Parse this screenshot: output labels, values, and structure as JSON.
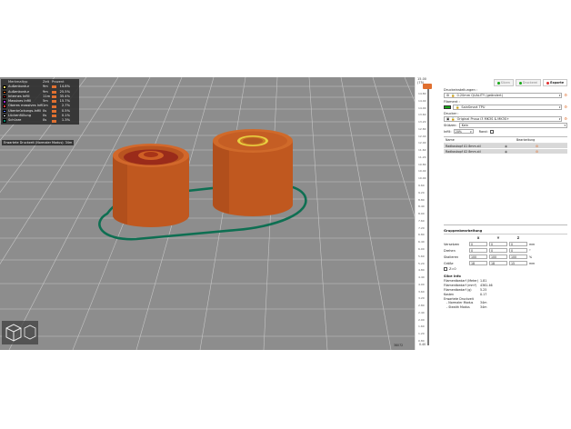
{
  "legend": {
    "headers": {
      "name": "Merkmaltyp",
      "time": "Zeit",
      "percent": "Prozent"
    },
    "items": [
      {
        "name": "Außenkontur",
        "time": "9m",
        "percent": "14.8%",
        "color": "#ffe066"
      },
      {
        "name": "Außenkontur",
        "time": "9m",
        "percent": "25.5%",
        "color": "#ff7a2a"
      },
      {
        "name": "Internes Infill",
        "time": "11m",
        "percent": "35.4%",
        "color": "#b01818"
      },
      {
        "name": "Massives Infill",
        "time": "5m",
        "percent": "15.7%",
        "color": "#a030d0"
      },
      {
        "name": "Oberes massives Infill",
        "time": "1m",
        "percent": "2.7%",
        "color": "#ff4040"
      },
      {
        "name": "Überbrückungs-Infill",
        "time": "0s",
        "percent": "0.5%",
        "color": "#6080ff"
      },
      {
        "name": "Lückenfüllung",
        "time": "0s",
        "percent": "0.1%",
        "color": "#ffffff"
      },
      {
        "name": "Schürze",
        "time": "0s",
        "percent": "1.3%",
        "color": "#00856a"
      }
    ],
    "estimate": "Erwartete Druckzeit (Normaler Modus): 34m"
  },
  "viewport": {
    "coord": "38072"
  },
  "vslider": {
    "top_label": "15.00",
    "top_sub": "(75)",
    "bottom_label": "0.40",
    "ticks": [
      "14.80",
      "14.40",
      "14.00",
      "13.60",
      "13.20",
      "12.80",
      "12.40",
      "12.00",
      "11.60",
      "11.20",
      "10.80",
      "10.40",
      "10.00",
      "9.60",
      "9.20",
      "8.80",
      "8.40",
      "8.00",
      "7.60",
      "7.20",
      "6.80",
      "6.40",
      "6.00",
      "5.60",
      "5.20",
      "4.80",
      "4.40",
      "4.00",
      "3.60",
      "3.20",
      "2.80",
      "2.40",
      "2.00",
      "1.60",
      "1.20",
      "0.80"
    ]
  },
  "panel": {
    "tabs": [
      {
        "label": "Slicen",
        "color": "#17a817",
        "active": false
      },
      {
        "label": "Druckerei",
        "color": "#17a817",
        "active": false
      },
      {
        "label": "Exporte",
        "color": "#e03030",
        "active": true
      }
    ],
    "print_settings_label": "Druckeinstellungen :",
    "print_settings_value": "0.20mm QUALITY (geändert)",
    "filament_label": "Filament :",
    "filament_value": "SainSmart TPU",
    "filament_color": "#17a817",
    "printer_label": "Drucker :",
    "printer_value": "Original Prusa i3 MK3S & MK3S+",
    "supports_label": "Stützen:",
    "supports_value": "Kein",
    "infill_label": "Infill:",
    "infill_value": "20%",
    "brim_label": "Rand:",
    "table_headers": {
      "name": "Name",
      "edit": "Bearbeitung"
    },
    "objects": [
      "Radkoskopf 01 8mm.stl",
      "Radkoskopf 02 8mm.stl"
    ],
    "manip": {
      "title": "Gruppenbearbeitung",
      "axes": [
        "X",
        "Y",
        "Z"
      ],
      "rows": [
        {
          "label": "Versetzen",
          "values": [
            "0",
            "0",
            "0"
          ],
          "unit": "mm"
        },
        {
          "label": "Drehen",
          "values": [
            "0",
            "0",
            "0"
          ],
          "unit": "°"
        },
        {
          "label": "Skalieren",
          "values": [
            "100",
            "100",
            "100"
          ],
          "unit": "%"
        },
        {
          "label": "Größe",
          "values": [
            "18",
            "18",
            "15"
          ],
          "unit": "mm"
        }
      ],
      "zoff_label": "Z=0"
    },
    "slice_info": {
      "title": "Slice Info",
      "rows": [
        {
          "k": "Filamentbedarf (Meter)",
          "v": "1.81"
        },
        {
          "k": "Filamentbedarf (mm³)",
          "v": "4361.46"
        },
        {
          "k": "Filamentbedarf (g)",
          "v": "5.25"
        },
        {
          "k": "Kosten",
          "v": "0.17"
        }
      ],
      "estimate_title": "Erwartete Druckzeit",
      "sub_rows": [
        {
          "k": "- Normaler Modus",
          "v": "34m"
        },
        {
          "k": "- Stealth Modus",
          "v": "34m"
        }
      ]
    }
  }
}
